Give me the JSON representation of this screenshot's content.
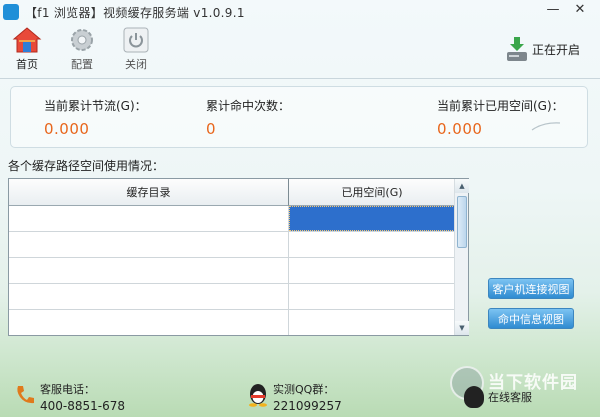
{
  "window": {
    "title": "【f1 浏览器】视频缓存服务端   v1.0.9.1",
    "minimize": "—",
    "close": "✕"
  },
  "toolbar": {
    "home": "首页",
    "settings": "配置",
    "close": "关闭",
    "status": "正在开启"
  },
  "stats": {
    "saved_label": "当前累计节流(G)：",
    "saved_value": "0.000",
    "hits_label": "累计命中次数：",
    "hits_value": "0",
    "used_label": "当前累计已用空间(G)：",
    "used_value": "0.000"
  },
  "cache": {
    "section_label": "各个缓存路径空间使用情况：",
    "columns": [
      "缓存目录",
      "已用空间(G)"
    ],
    "rows": [
      [
        "",
        ""
      ],
      [
        "",
        ""
      ],
      [
        "",
        ""
      ],
      [
        "",
        ""
      ],
      [
        "",
        ""
      ]
    ]
  },
  "buttons": {
    "client_view": "客户机连接视图",
    "hit_view": "命中信息视图"
  },
  "footer": {
    "phone_label": "客服电话：",
    "phone_value": "400-8851-678",
    "qq_label": "实测QQ群：",
    "qq_value": "221099257"
  },
  "watermark": {
    "title": "当下软件园",
    "subtitle": "在线客服"
  },
  "colors": {
    "value_orange": "#e8661c",
    "selection_blue": "#2d6fcc",
    "button_blue": "#2f8bd1"
  }
}
